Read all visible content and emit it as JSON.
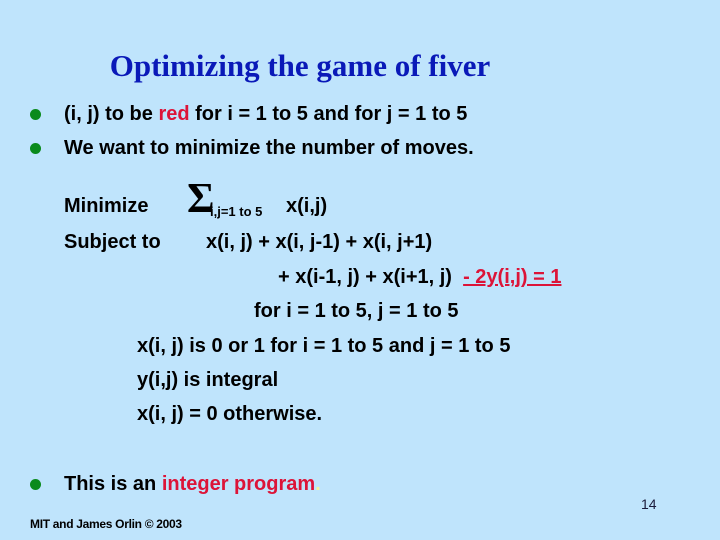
{
  "slide": {
    "title": "Optimizing the game of fiver",
    "bullets": [
      {
        "parts": [
          "(i, j) to be ",
          "red",
          " for i = 1 to 5 and for j = 1 to 5"
        ]
      },
      {
        "text": "We want to minimize the number of moves."
      }
    ],
    "formulation": {
      "minimize_label": "Minimize",
      "sigma": "Σ",
      "sum_subscript": "i,j=1 to 5",
      "objective": "x(i,j)",
      "subject_to_label": "Subject to",
      "constraint_line1": "x(i, j) + x(i, j-1) + x(i, j+1)",
      "constraint_line2": "+ x(i-1, j) + x(i+1, j)",
      "constraint_line2_red": "- 2y(i,j) = 1",
      "constraint_range": "for i = 1 to 5, j = 1 to 5",
      "binary_constraint": "x(i, j) is 0 or 1 for i = 1 to 5 and j = 1 to 5",
      "integral_constraint": "y(i,j) is integral",
      "otherwise_constraint": "x(i, j) = 0 otherwise."
    },
    "final_bullet": {
      "prefix": "This is an ",
      "highlight": "integer program",
      "suffix": "."
    },
    "page_number": "14",
    "footer": "MIT and James Orlin © 2003",
    "colors": {
      "background": "#bfe4fc",
      "title": "#0a19b8",
      "accent_red": "#dc1438",
      "bullet": "#0a8a1c"
    }
  }
}
